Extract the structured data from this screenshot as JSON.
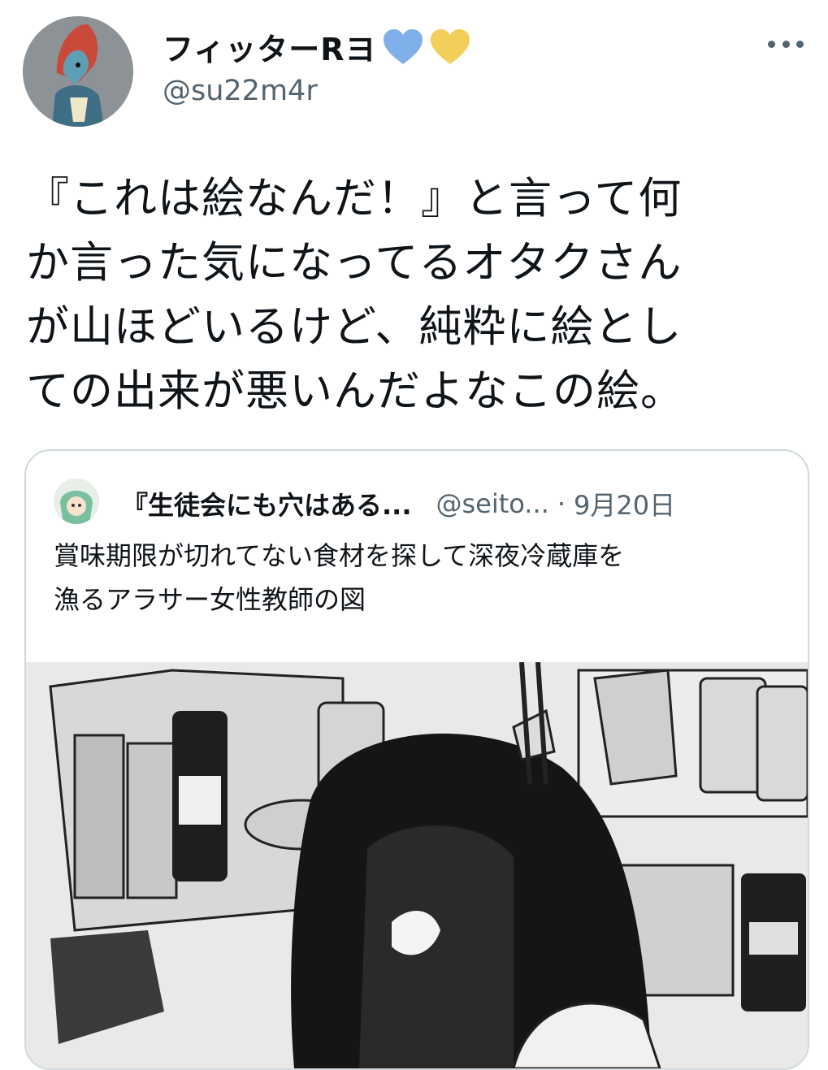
{
  "tweet": {
    "display_name": "フィッターRヨ",
    "handle": "@su22m4r",
    "text": "『これは絵なんだ！』と言って何\nか言った気になってるオタクさん\nが山ほどいるけど、純粋に絵とし\nての出来が悪いんだよなこの絵。"
  },
  "quoted": {
    "name": "『生徒会にも穴はある...",
    "handle": "@seito...",
    "separator": "·",
    "date": "9月20日",
    "text": "賞味期限が切れてない食材を探して深夜冷蔵庫を\n漁るアラサー女性教師の図"
  },
  "colors": {
    "heart_blue": "#7fb0ea",
    "heart_yellow": "#f2cf5b",
    "secondary_text": "#536471"
  },
  "icons": [
    "avatar",
    "blue-heart-icon",
    "yellow-heart-icon",
    "more-icon"
  ]
}
